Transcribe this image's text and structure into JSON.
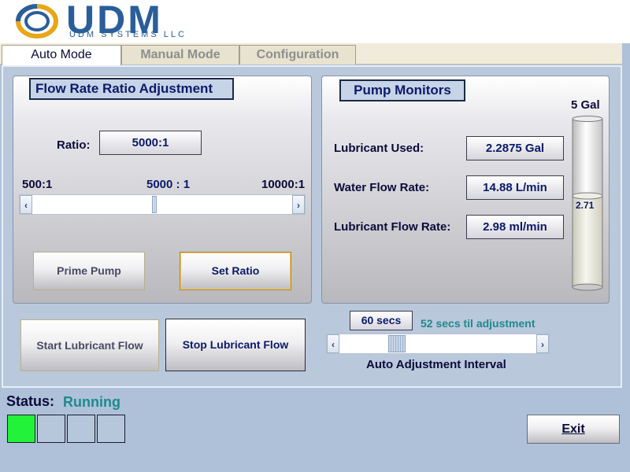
{
  "header": {
    "logo_word": "UDM",
    "logo_subtitle": "UDM SYSTEMS LLC"
  },
  "tabs": [
    {
      "label": "Auto Mode",
      "active": true
    },
    {
      "label": "Manual Mode",
      "active": false
    },
    {
      "label": "Configuration",
      "active": false
    }
  ],
  "flow_ratio": {
    "title": "Flow Rate Ratio Adjustment",
    "ratio_label": "Ratio:",
    "ratio_value": "5000:1",
    "scale_min_label": "500:1",
    "scale_mid_label": "5000 : 1",
    "scale_max_label": "10000:1",
    "slider_position": 0.47,
    "prime_pump_label": "Prime Pump",
    "set_ratio_label": "Set Ratio"
  },
  "pump_monitors": {
    "title": "Pump Monitors",
    "rows": [
      {
        "label": "Lubricant Used:",
        "value": "2.2875 Gal"
      },
      {
        "label": "Water Flow Rate:",
        "value": "14.88 L/min"
      },
      {
        "label": "Lubricant Flow Rate:",
        "value": "2.98 ml/min"
      }
    ],
    "tank_capacity_label": "5 Gal",
    "tank_level_label": "2.71",
    "tank_capacity_gal": 5,
    "tank_level_gal": 2.71
  },
  "flow_controls": {
    "start_label": "Start Lubricant Flow",
    "stop_label": "Stop Lubricant Flow"
  },
  "auto_adjust": {
    "interval_value": "60 secs",
    "countdown_text": "52 secs til adjustment",
    "interval_label": "Auto Adjustment Interval",
    "slider_position": 0.27
  },
  "status": {
    "label": "Status:",
    "value": "Running",
    "indicators": [
      "on",
      "off",
      "off",
      "off"
    ]
  },
  "exit_label": "Exit",
  "colors": {
    "background": "#aec1d9",
    "status_running": "#1f8a8a",
    "countdown": "#1f8a8a",
    "indicator_on": "#22f23a",
    "logo_blue": "#2a5e9a",
    "logo_gold": "#e8a517"
  },
  "icons": [
    "logo-ring-icon",
    "slider-left-arrow-icon",
    "slider-right-arrow-icon",
    "tank-icon"
  ]
}
